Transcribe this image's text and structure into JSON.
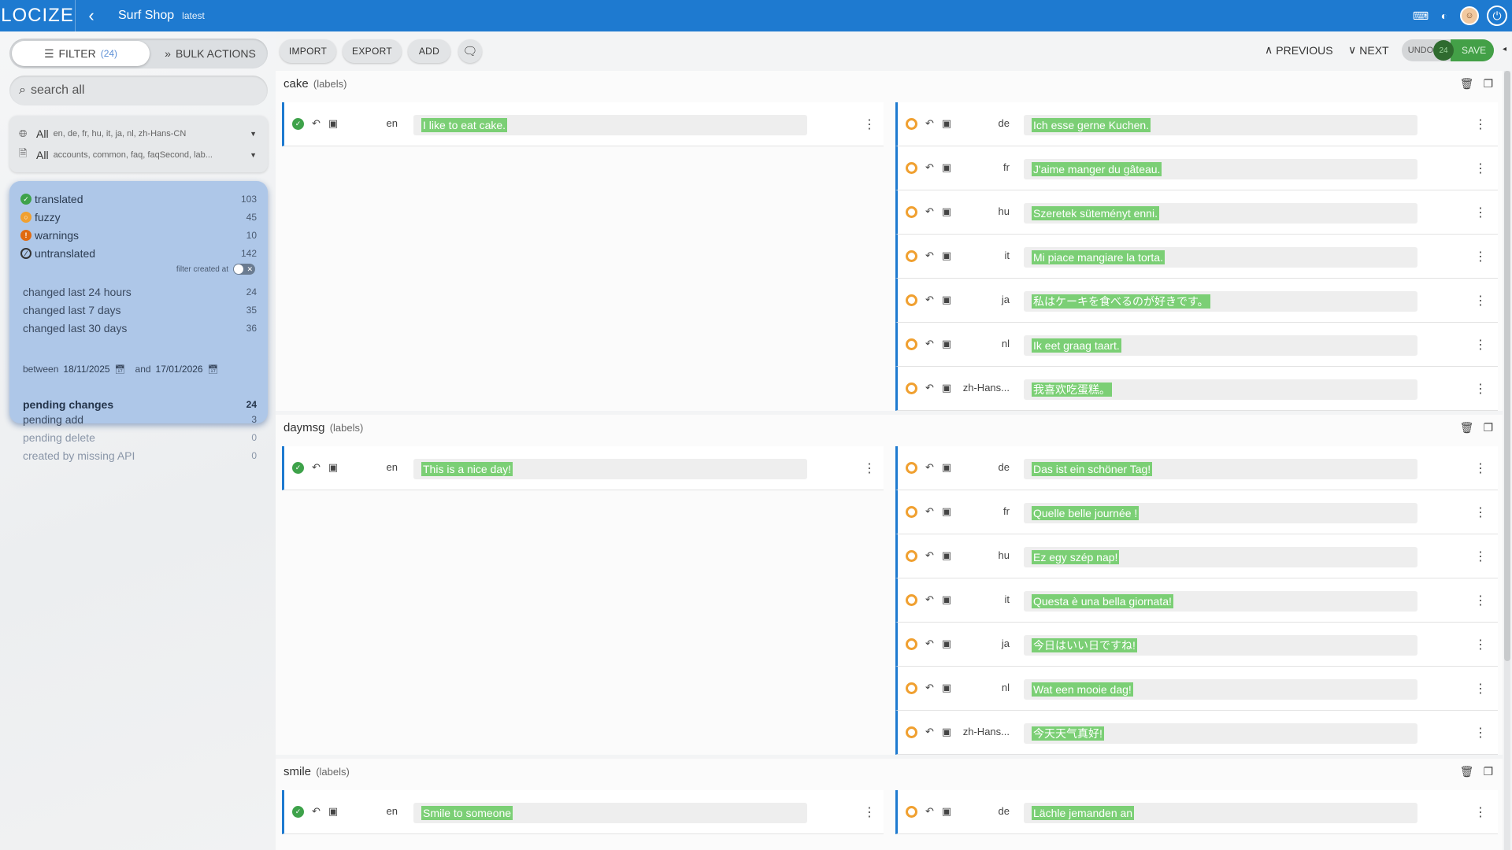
{
  "app": {
    "logo": "LOCIZE",
    "project": "Surf Shop",
    "version": "latest"
  },
  "sidebar": {
    "filter_label": "FILTER",
    "filter_count": "(24)",
    "bulk_label": "BULK ACTIONS",
    "search_placeholder": "search all",
    "languages": {
      "main": "All",
      "sub": "en, de, fr, hu, it, ja, nl, zh-Hans-CN"
    },
    "namespaces": {
      "main": "All",
      "sub": "accounts, common, faq, faqSecond, lab..."
    },
    "stats": [
      {
        "label": "translated",
        "value": "103"
      },
      {
        "label": "fuzzy",
        "value": "45"
      },
      {
        "label": "warnings",
        "value": "10"
      },
      {
        "label": "untranslated",
        "value": "142"
      }
    ],
    "filter_created_at": "filter created at",
    "changes": [
      {
        "label": "changed last 24 hours",
        "value": "24"
      },
      {
        "label": "changed last 7 days",
        "value": "35"
      },
      {
        "label": "changed last 30 days",
        "value": "36"
      }
    ],
    "between": {
      "label": "between",
      "from": "18/11/2025",
      "and": "and",
      "to": "17/01/2026"
    },
    "pending": [
      {
        "label": "pending changes",
        "value": "24"
      },
      {
        "label": "pending add",
        "value": "3"
      },
      {
        "label": "pending delete",
        "value": "0"
      },
      {
        "label": "created by missing API",
        "value": "0"
      }
    ]
  },
  "toolbar": {
    "import": "IMPORT",
    "export": "EXPORT",
    "add": "ADD",
    "previous": "PREVIOUS",
    "next": "NEXT",
    "undo": "UNDO",
    "pending_count": "24",
    "save": "SAVE"
  },
  "groups": [
    {
      "key": "cake",
      "ns": "(labels)",
      "source": {
        "lang": "en",
        "text": "I like to eat cake."
      },
      "translations": [
        {
          "lang": "de",
          "text": "Ich esse gerne Kuchen."
        },
        {
          "lang": "fr",
          "text": "J'aime manger du gâteau."
        },
        {
          "lang": "hu",
          "text": "Szeretek süteményt enni."
        },
        {
          "lang": "it",
          "text": "Mi piace mangiare la torta."
        },
        {
          "lang": "ja",
          "text": "私はケーキを食べるのが好きです。"
        },
        {
          "lang": "nl",
          "text": "Ik eet graag taart."
        },
        {
          "lang": "zh-Hans...",
          "text": "我喜欢吃蛋糕。"
        }
      ]
    },
    {
      "key": "daymsg",
      "ns": "(labels)",
      "source": {
        "lang": "en",
        "text": "This is a nice day!"
      },
      "translations": [
        {
          "lang": "de",
          "text": "Das ist ein schöner Tag!"
        },
        {
          "lang": "fr",
          "text": "Quelle belle journée !"
        },
        {
          "lang": "hu",
          "text": "Ez egy szép nap!"
        },
        {
          "lang": "it",
          "text": "Questa è una bella giornata!"
        },
        {
          "lang": "ja",
          "text": "今日はいい日ですね!"
        },
        {
          "lang": "nl",
          "text": "Wat een mooie dag!"
        },
        {
          "lang": "zh-Hans...",
          "text": "今天天气真好!"
        }
      ]
    },
    {
      "key": "smile",
      "ns": "(labels)",
      "source": {
        "lang": "en",
        "text": "Smile to someone"
      },
      "translations": [
        {
          "lang": "de",
          "text": "Lächle jemanden an"
        }
      ]
    }
  ],
  "colors": {
    "topbar": "#1e7ad0",
    "highlight": "#7bcf75",
    "save": "#43a047",
    "stats_bg": "#aec7e8"
  }
}
